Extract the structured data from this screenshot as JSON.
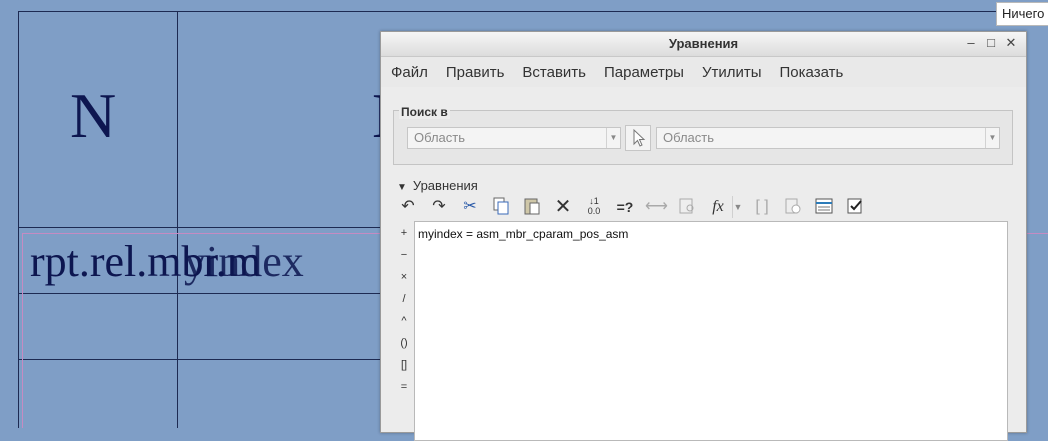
{
  "background": {
    "header_cell_1": "N",
    "header_cell_2": "N",
    "row_text": "rpt.rel.mbr.m",
    "row_overlap_text": "yindex"
  },
  "tooltip": {
    "text": "Ничего"
  },
  "dialog": {
    "title": "Уравнения",
    "menu": [
      "Файл",
      "Править",
      "Вставить",
      "Параметры",
      "Утилиты",
      "Показать"
    ],
    "search": {
      "label": "Поиск в",
      "scope_left": "Область",
      "scope_right": "Область"
    },
    "equations_section": {
      "label": "Уравнения",
      "expanded": true
    },
    "toolbar_icons": [
      "undo-icon",
      "redo-icon",
      "cut-icon",
      "copy-icon",
      "paste-icon",
      "delete-icon",
      "sort-icon",
      "evaluate-icon",
      "measure-icon",
      "find-icon",
      "function-icon",
      "brackets-icon",
      "verify-icon",
      "table-icon",
      "check-icon"
    ],
    "operators": [
      "+",
      "−",
      "×",
      "/",
      "^",
      "()",
      "[]",
      "="
    ],
    "editor": {
      "content": "myindex = asm_mbr_cparam_pos_asm"
    }
  }
}
